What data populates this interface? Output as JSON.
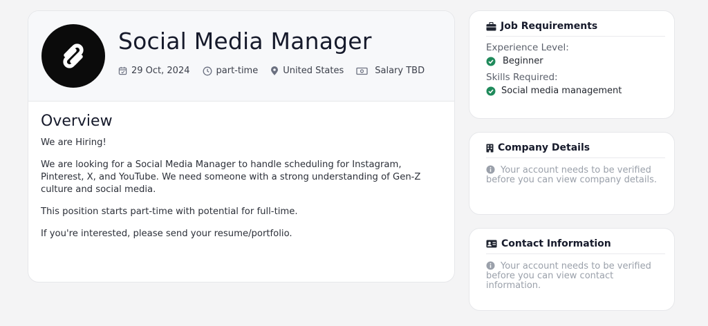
{
  "job": {
    "title": "Social Media Manager",
    "meta": {
      "date": "29 Oct, 2024",
      "type": "part-time",
      "location": "United States",
      "salary": "Salary TBD"
    }
  },
  "overview": {
    "title": "Overview",
    "paragraphs": [
      "We are Hiring!",
      "We are looking for a Social Media Manager to handle scheduling for Instagram, Pinterest, X, and YouTube. We need someone with a strong understanding of Gen-Z culture and social media.",
      "This position starts part-time with potential for full-time.",
      "If you're interested, please send your resume/portfolio."
    ]
  },
  "requirements": {
    "title": "Job Requirements",
    "experience_label": "Experience Level:",
    "experience_value": "Beginner",
    "skills_label": "Skills Required:",
    "skills": [
      "Social media management"
    ]
  },
  "company": {
    "title": "Company Details",
    "message": "Your account needs to be verified before you can view company details."
  },
  "contact": {
    "title": "Contact Information",
    "message": "Your account needs to be verified before you can view contact information."
  },
  "colors": {
    "check_green": "#1f8a5b",
    "background": "#f4f4f5",
    "header_bg": "#f7f8fa"
  }
}
